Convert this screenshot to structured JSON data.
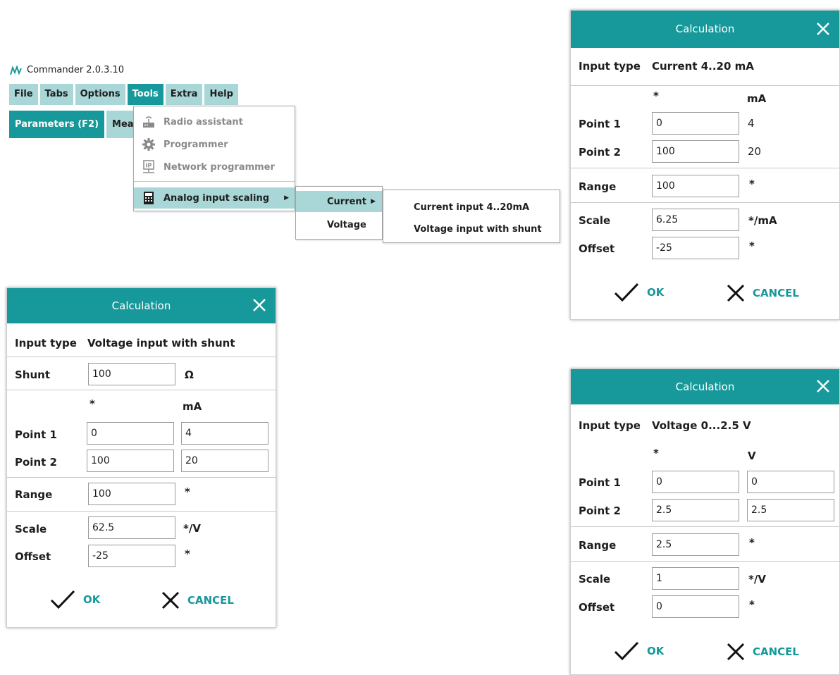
{
  "app": {
    "title": "Commander 2.0.3.10",
    "menu": [
      "File",
      "Tabs",
      "Options",
      "Tools",
      "Extra",
      "Help"
    ],
    "tabs": [
      "Parameters (F2)",
      "Mea"
    ]
  },
  "tools_menu": {
    "items": [
      "Radio assistant",
      "Programmer",
      "Network programmer",
      "Analog input scaling"
    ]
  },
  "scaling_submenu": {
    "items": [
      "Current",
      "Voltage"
    ]
  },
  "current_submenu": {
    "items": [
      "Current input 4..20mA",
      "Voltage input with shunt"
    ]
  },
  "dialog_shunt": {
    "title": "Calculation",
    "input_type_label": "Input type",
    "input_type_value": "Voltage input with shunt",
    "shunt_label": "Shunt",
    "shunt_value": "100",
    "shunt_unit": "Ω",
    "col1_header": "*",
    "col2_header": "mA",
    "point1_label": "Point 1",
    "point1_a": "0",
    "point1_b": "4",
    "point2_label": "Point 2",
    "point2_a": "100",
    "point2_b": "20",
    "range_label": "Range",
    "range_value": "100",
    "range_unit": "*",
    "scale_label": "Scale",
    "scale_value": "62.5",
    "scale_unit": "*/V",
    "offset_label": "Offset",
    "offset_value": "-25",
    "offset_unit": "*",
    "ok_label": "OK",
    "cancel_label": "CANCEL"
  },
  "dialog_current": {
    "title": "Calculation",
    "input_type_label": "Input type",
    "input_type_value": "Current 4..20 mA",
    "col1_header": "*",
    "col2_header": "mA",
    "point1_label": "Point 1",
    "point1_a": "0",
    "point1_b": "4",
    "point2_label": "Point 2",
    "point2_a": "100",
    "point2_b": "20",
    "range_label": "Range",
    "range_value": "100",
    "range_unit": "*",
    "scale_label": "Scale",
    "scale_value": "6.25",
    "scale_unit": "*/mA",
    "offset_label": "Offset",
    "offset_value": "-25",
    "offset_unit": "*",
    "ok_label": "OK",
    "cancel_label": "CANCEL"
  },
  "dialog_voltage": {
    "title": "Calculation",
    "input_type_label": "Input type",
    "input_type_value": "Voltage 0...2.5 V",
    "col1_header": "*",
    "col2_header": "V",
    "point1_label": "Point 1",
    "point1_a": "0",
    "point1_b": "0",
    "point2_label": "Point 2",
    "point2_a": "2.5",
    "point2_b": "2.5",
    "range_label": "Range",
    "range_value": "2.5",
    "range_unit": "*",
    "scale_label": "Scale",
    "scale_value": "1",
    "scale_unit": "*/V",
    "offset_label": "Offset",
    "offset_value": "0",
    "offset_unit": "*",
    "ok_label": "OK",
    "cancel_label": "CANCEL"
  },
  "colors": {
    "accent": "#17989a",
    "menu_bg": "#a9d6d6",
    "disabled": "#8a8a8a"
  }
}
